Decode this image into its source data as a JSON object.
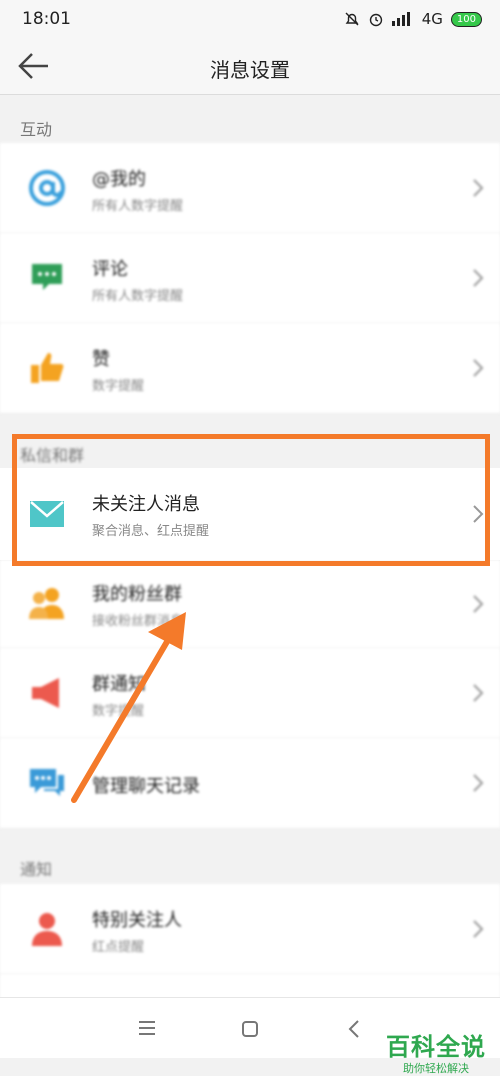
{
  "status": {
    "time": "18:01",
    "network": "4G",
    "battery": "100"
  },
  "header": {
    "title": "消息设置"
  },
  "sections": [
    {
      "label": "互动",
      "rows": [
        {
          "title": "@我的",
          "subtitle": "所有人数字提醒"
        },
        {
          "title": "评论",
          "subtitle": "所有人数字提醒"
        },
        {
          "title": "赞",
          "subtitle": "数字提醒"
        }
      ]
    },
    {
      "label": "私信和群",
      "rows": [
        {
          "title": "未关注人消息",
          "subtitle": "聚合消息、红点提醒"
        },
        {
          "title": "我的粉丝群",
          "subtitle": "接收粉丝群消息"
        },
        {
          "title": "群通知",
          "subtitle": "数字提醒"
        },
        {
          "title": "管理聊天记录",
          "subtitle": ""
        }
      ]
    },
    {
      "label": "通知",
      "rows": [
        {
          "title": "特别关注人",
          "subtitle": "红点提醒"
        }
      ]
    }
  ],
  "watermark": {
    "line1": "百科全说",
    "line2": "助你轻松解决"
  },
  "colors": {
    "accent_orange": "#f47a2a",
    "watermark_green": "#2fa84f"
  },
  "icons": [
    "at-icon",
    "comment-icon",
    "like-icon",
    "mail-icon",
    "fans-group-icon",
    "speaker-icon",
    "chat-records-icon",
    "special-follow-icon"
  ]
}
